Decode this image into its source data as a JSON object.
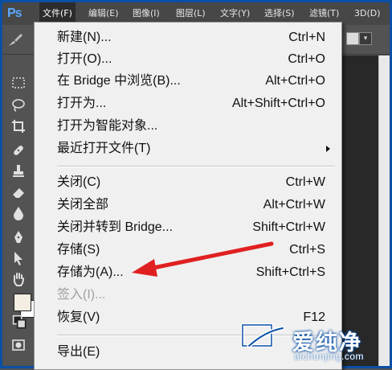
{
  "app": {
    "logo_text": "Ps"
  },
  "menubar": {
    "items": [
      {
        "label": "文件(F)",
        "active": true
      },
      {
        "label": "编辑(E)"
      },
      {
        "label": "图像(I)"
      },
      {
        "label": "图层(L)"
      },
      {
        "label": "文字(Y)"
      },
      {
        "label": "选择(S)"
      },
      {
        "label": "滤镜(T)"
      },
      {
        "label": "3D(D)"
      }
    ]
  },
  "options": {
    "dropdown_glyph": "▾"
  },
  "colors": {
    "accent_frame": "#0a4fa6",
    "annotation_arrow": "#e02020",
    "foreground_swatch": "#f3ede2",
    "background_swatch": "#ffffff"
  },
  "file_menu": {
    "items": [
      {
        "label": "新建(N)...",
        "shortcut": "Ctrl+N"
      },
      {
        "label": "打开(O)...",
        "shortcut": "Ctrl+O"
      },
      {
        "label": "在 Bridge 中浏览(B)...",
        "shortcut": "Alt+Ctrl+O"
      },
      {
        "label": "打开为...",
        "shortcut": "Alt+Shift+Ctrl+O"
      },
      {
        "label": "打开为智能对象...",
        "shortcut": ""
      },
      {
        "label": "最近打开文件(T)",
        "shortcut": "",
        "submenu": true
      },
      {
        "label": "关闭(C)",
        "shortcut": "Ctrl+W"
      },
      {
        "label": "关闭全部",
        "shortcut": "Alt+Ctrl+W"
      },
      {
        "label": "关闭并转到 Bridge...",
        "shortcut": "Shift+Ctrl+W"
      },
      {
        "label": "存储(S)",
        "shortcut": "Ctrl+S"
      },
      {
        "label": "存储为(A)...",
        "shortcut": "Shift+Ctrl+S",
        "highlighted_by_annotation": true
      },
      {
        "label": "签入(I)...",
        "shortcut": "",
        "disabled": true
      },
      {
        "label": "恢复(V)",
        "shortcut": "F12"
      },
      {
        "label": "导出(E)",
        "shortcut": ""
      }
    ]
  },
  "watermark": {
    "brand": "爱纯净",
    "domain": "aichunjing.com"
  },
  "icons": [
    "brush-icon",
    "marquee-icon",
    "lasso-icon",
    "crop-icon",
    "healing-icon",
    "stamp-icon",
    "eraser-icon",
    "blur-icon",
    "pen-icon",
    "path-select-icon",
    "hand-icon",
    "swap-colors-icon",
    "quick-mask-icon",
    "submenu-arrow-icon",
    "watermark-logo-icon"
  ]
}
